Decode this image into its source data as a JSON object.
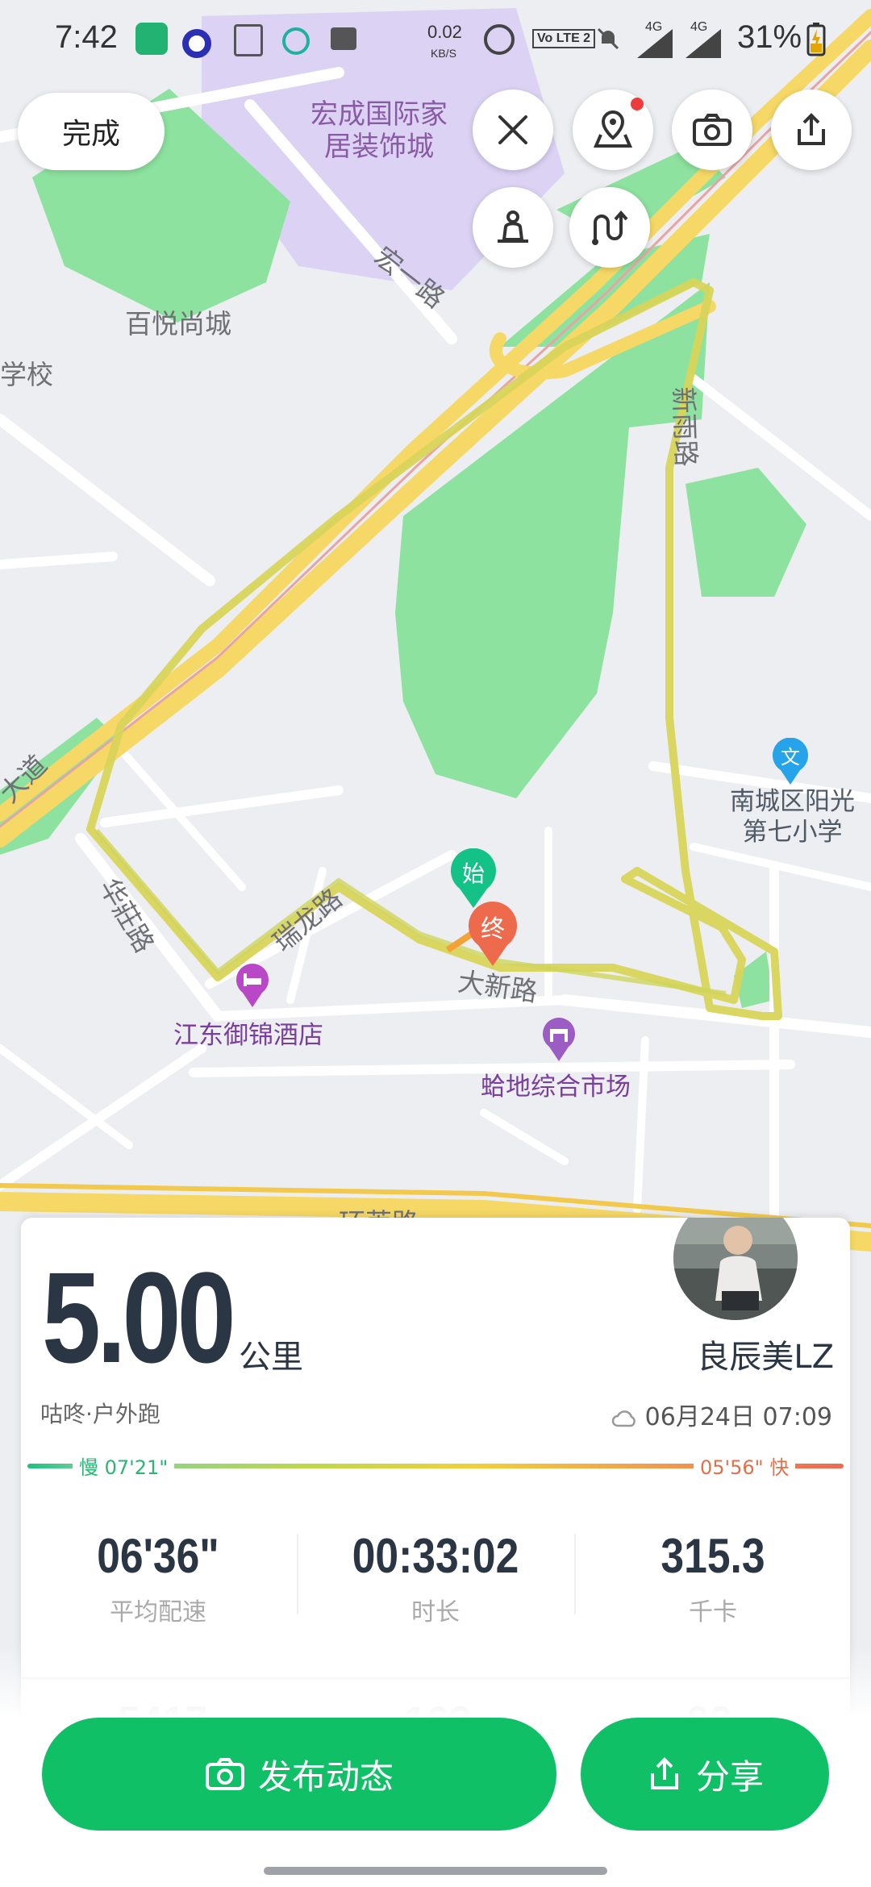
{
  "status_bar": {
    "time": "7:42",
    "net_speed": "0.02",
    "net_unit": "KB/S",
    "volte": "Vo LTE 2",
    "signal1": "4G",
    "signal2": "4G",
    "battery": "31%"
  },
  "top": {
    "done_label": "完成"
  },
  "map": {
    "labels": {
      "hongcheng_1": "宏成国际家",
      "hongcheng_2": "居装饰城",
      "hongyi_road": "宏一路",
      "baiyue": "百悦尚城",
      "school_partial": "学校",
      "road_a": "新雨路",
      "school_1": "南城区阳光",
      "school_2": "第七小学",
      "road_b": "大新路",
      "road_c": "华莊路",
      "road_d": "瑞龙路",
      "hotel": "江东御锦酒店",
      "market": "蛤地综合市场",
      "avenue_partial": "大道",
      "bottom_road_partial": "环莱路"
    },
    "start_marker": "始",
    "end_marker": "终",
    "school_marker": "文"
  },
  "card": {
    "distance": "5.00",
    "distance_unit": "公里",
    "username": "良辰美LZ",
    "activity_type": "咕咚·户外跑",
    "datetime": "06月24日 07:09",
    "pace_slow": "慢 07'21\"",
    "pace_fast": "05'56\" 快",
    "stats": [
      {
        "value": "06'36\"",
        "label": "平均配速"
      },
      {
        "value": "00:33:02",
        "label": "时长"
      },
      {
        "value": "315.3",
        "label": "千卡"
      }
    ],
    "peek_values": [
      "5417",
      "162",
      "92"
    ]
  },
  "actions": {
    "publish_label": "发布动态",
    "share_label": "分享"
  },
  "colors": {
    "primary_green": "#10c066",
    "route_yellow": "#d8d45a",
    "park_green": "#8de29f",
    "road_yellow": "#f5d866",
    "purple_area": "#dcd3f4"
  }
}
